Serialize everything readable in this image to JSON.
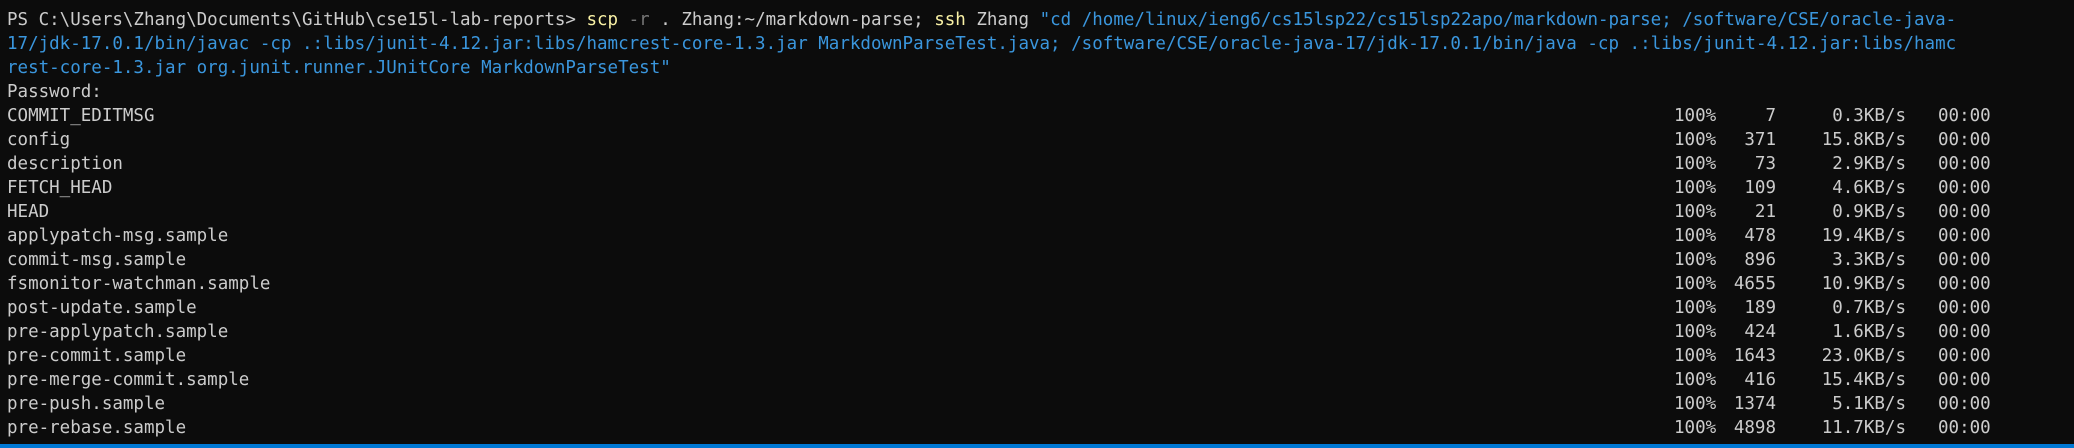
{
  "prompt": {
    "text": "PS C:\\Users\\Zhang\\Documents\\GitHub\\cse15l-lab-reports> "
  },
  "command": {
    "scp_cmd": "scp",
    "scp_flag": "-r",
    "scp_args": " . Zhang:~/markdown-parse; ",
    "ssh_cmd": "ssh",
    "ssh_host": " Zhang ",
    "ssh_str_1": "\"cd /home/linux/ieng6/cs15lsp22/cs15lsp22apo/markdown-parse; /software/CSE/oracle-java-",
    "ssh_str_2": "17/jdk-17.0.1/bin/javac -cp .:libs/junit-4.12.jar:libs/hamcrest-core-1.3.jar MarkdownParseTest.java; /software/CSE/oracle-java-17/jdk-17.0.1/bin/java -cp .:libs/junit-4.12.jar:libs/hamc",
    "ssh_str_3": "rest-core-1.3.jar org.junit.runner.JUnitCore MarkdownParseTest\""
  },
  "password_prompt": "Password:",
  "transfers": [
    {
      "name": "COMMIT_EDITMSG",
      "pct": "100%",
      "size": "7",
      "rate": "0.3KB/s",
      "time": "00:00"
    },
    {
      "name": "config",
      "pct": "100%",
      "size": "371",
      "rate": "15.8KB/s",
      "time": "00:00"
    },
    {
      "name": "description",
      "pct": "100%",
      "size": "73",
      "rate": "2.9KB/s",
      "time": "00:00"
    },
    {
      "name": "FETCH_HEAD",
      "pct": "100%",
      "size": "109",
      "rate": "4.6KB/s",
      "time": "00:00"
    },
    {
      "name": "HEAD",
      "pct": "100%",
      "size": "21",
      "rate": "0.9KB/s",
      "time": "00:00"
    },
    {
      "name": "applypatch-msg.sample",
      "pct": "100%",
      "size": "478",
      "rate": "19.4KB/s",
      "time": "00:00"
    },
    {
      "name": "commit-msg.sample",
      "pct": "100%",
      "size": "896",
      "rate": "3.3KB/s",
      "time": "00:00"
    },
    {
      "name": "fsmonitor-watchman.sample",
      "pct": "100%",
      "size": "4655",
      "rate": "10.9KB/s",
      "time": "00:00"
    },
    {
      "name": "post-update.sample",
      "pct": "100%",
      "size": "189",
      "rate": "0.7KB/s",
      "time": "00:00"
    },
    {
      "name": "pre-applypatch.sample",
      "pct": "100%",
      "size": "424",
      "rate": "1.6KB/s",
      "time": "00:00"
    },
    {
      "name": "pre-commit.sample",
      "pct": "100%",
      "size": "1643",
      "rate": "23.0KB/s",
      "time": "00:00"
    },
    {
      "name": "pre-merge-commit.sample",
      "pct": "100%",
      "size": "416",
      "rate": "15.4KB/s",
      "time": "00:00"
    },
    {
      "name": "pre-push.sample",
      "pct": "100%",
      "size": "1374",
      "rate": "5.1KB/s",
      "time": "00:00"
    },
    {
      "name": "pre-rebase.sample",
      "pct": "100%",
      "size": "4898",
      "rate": "11.7KB/s",
      "time": "00:00"
    }
  ],
  "colors": {
    "background": "#0c0c0c",
    "foreground": "#cccccc",
    "command": "#f9f1a5",
    "flag": "#767676",
    "string": "#3a96dd",
    "accent_bar": "#0078d4"
  }
}
